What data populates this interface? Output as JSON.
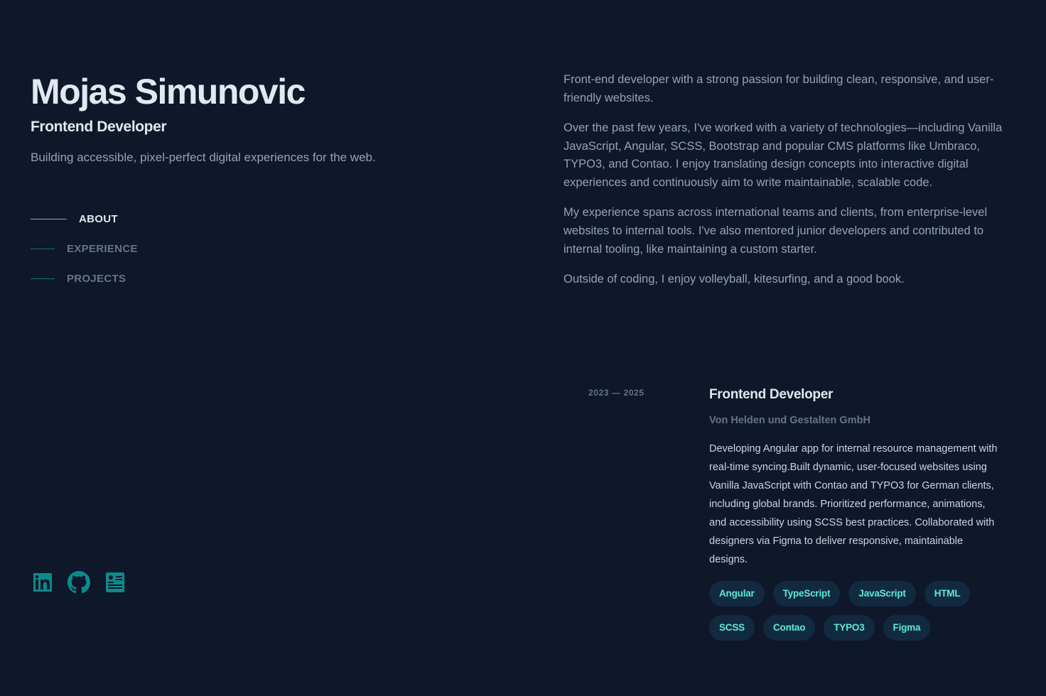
{
  "header": {
    "name": "Mojas Simunovic",
    "role": "Frontend Developer",
    "tagline": "Building accessible, pixel-perfect digital experiences for the web."
  },
  "nav": {
    "items": [
      {
        "label": "ABOUT",
        "active": true
      },
      {
        "label": "EXPERIENCE",
        "active": false
      },
      {
        "label": "PROJECTS",
        "active": false
      }
    ]
  },
  "socials": {
    "items": [
      {
        "icon": "linkedin-icon"
      },
      {
        "icon": "github-icon"
      },
      {
        "icon": "resume-icon"
      }
    ]
  },
  "about": {
    "paragraphs": [
      "Front-end developer with a strong passion for building clean, responsive, and user-friendly websites.",
      "Over the past few years, I've worked with a variety of technologies—including Vanilla JavaScript, Angular, SCSS, Bootstrap and popular CMS platforms like Umbraco, TYPO3, and Contao. I enjoy translating design concepts into interactive digital experiences and continuously aim to write maintainable, scalable code.",
      "My experience spans across international teams and clients, from enterprise-level websites to internal tools. I've also mentored junior developers and contributed to internal tooling, like maintaining a custom starter.",
      "Outside of coding, I enjoy volleyball, kitesurfing, and a good book."
    ]
  },
  "experience": {
    "date": "2023 — 2025",
    "title": "Frontend Developer",
    "company": "Von Helden und Gestalten GmbH",
    "description": "Developing Angular app for internal resource management with real-time syncing.Built dynamic, user-focused websites using Vanilla JavaScript with Contao and TYPO3 for German clients, including global brands. Prioritized performance, animations, and accessibility using SCSS best practices. Collaborated with designers via Figma to deliver responsive, maintainable designs.",
    "tags": [
      "Angular",
      "TypeScript",
      "JavaScript",
      "HTML",
      "SCSS",
      "Contao",
      "TYPO3",
      "Figma"
    ]
  },
  "colors": {
    "background": "#0f172a",
    "heading": "#e2e8f0",
    "body": "#94a3b8",
    "accent": "#5eead4",
    "tag_bg": "#112a3f",
    "icon": "#0d8a8a"
  }
}
